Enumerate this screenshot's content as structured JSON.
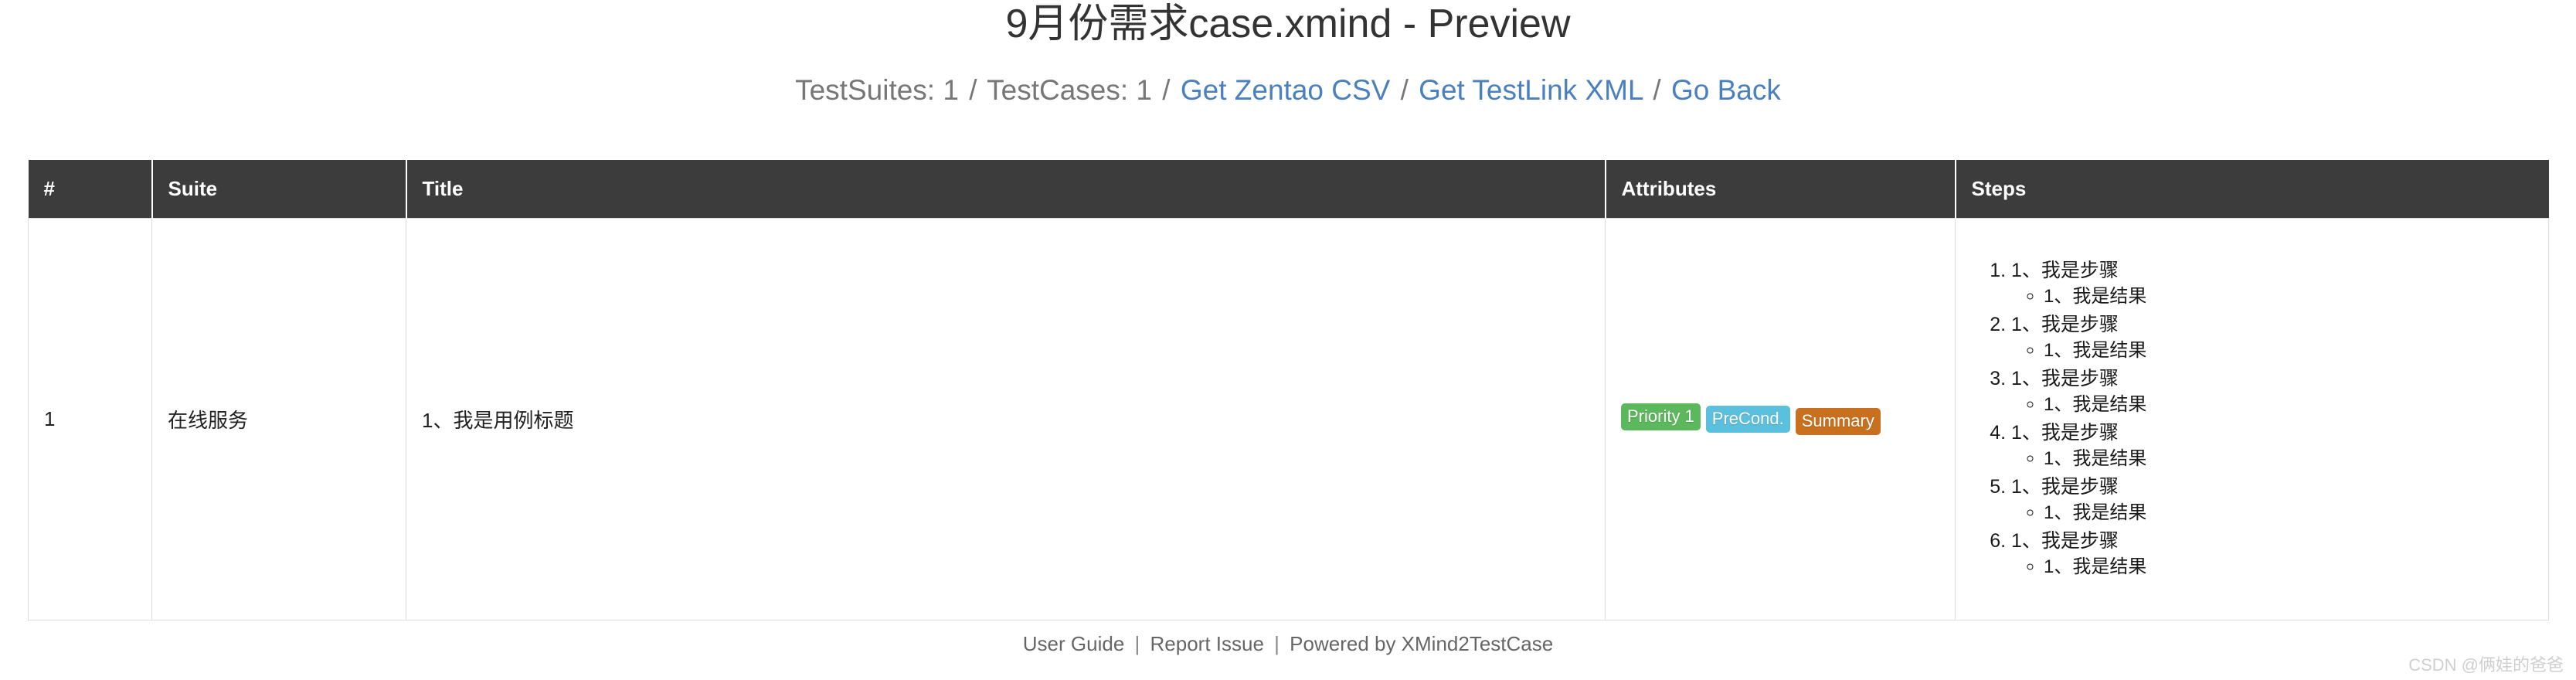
{
  "header": {
    "title": "9月份需求case.xmind - Preview",
    "summary": {
      "testsuites_label": "TestSuites: 1",
      "testcases_label": "TestCases: 1",
      "separator": "/",
      "links": [
        {
          "label": "Get Zentao CSV"
        },
        {
          "label": "Get TestLink XML"
        },
        {
          "label": "Go Back"
        }
      ]
    }
  },
  "table": {
    "columns": [
      {
        "key": "index",
        "label": "#"
      },
      {
        "key": "suite",
        "label": "Suite"
      },
      {
        "key": "title",
        "label": "Title"
      },
      {
        "key": "attributes",
        "label": "Attributes"
      },
      {
        "key": "steps",
        "label": "Steps"
      }
    ],
    "rows": [
      {
        "index": "1",
        "suite": "在线服务",
        "title": "1、我是用例标题",
        "attributes": [
          {
            "label": "Priority 1",
            "color": "#5cb85c",
            "kind": "priority"
          },
          {
            "label": "PreCond.",
            "color": "#5bc0de",
            "kind": "precondition"
          },
          {
            "label": "Summary",
            "color": "#c8701e",
            "kind": "summary"
          }
        ],
        "steps": [
          {
            "action": "1、我是步骤",
            "expected": "1、我是结果"
          },
          {
            "action": "1、我是步骤",
            "expected": "1、我是结果"
          },
          {
            "action": "1、我是步骤",
            "expected": "1、我是结果"
          },
          {
            "action": "1、我是步骤",
            "expected": "1、我是结果"
          },
          {
            "action": "1、我是步骤",
            "expected": "1、我是结果"
          },
          {
            "action": "1、我是步骤",
            "expected": "1、我是结果"
          }
        ]
      }
    ]
  },
  "footer": {
    "links": [
      {
        "label": "User Guide"
      },
      {
        "label": "Report Issue"
      },
      {
        "label": "Powered by XMind2TestCase"
      }
    ],
    "separator": "|"
  },
  "watermark": {
    "text": "CSDN @俩娃的爸爸"
  },
  "theme": {
    "header_bg": "#3c3c3c",
    "link_color": "#4a80c0",
    "border_color": "#dddddd",
    "muted_text": "#777777"
  }
}
